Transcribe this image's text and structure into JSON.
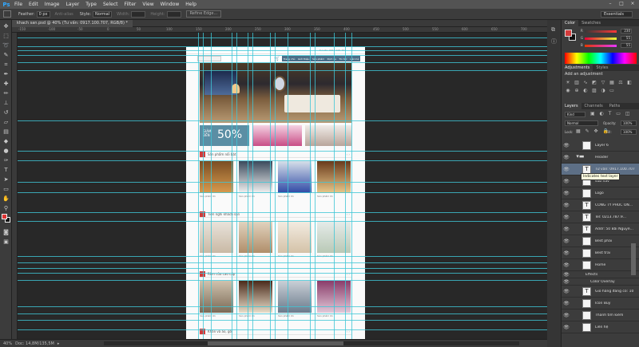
{
  "app": {
    "logo": "Ps"
  },
  "menu": [
    "File",
    "Edit",
    "Image",
    "Layer",
    "Type",
    "Select",
    "Filter",
    "View",
    "Window",
    "Help"
  ],
  "window_controls": [
    "–",
    "□",
    "×"
  ],
  "options_bar": {
    "feather_label": "Feather:",
    "feather_value": "0 px",
    "anti_alias": "Anti-alias",
    "style_label": "Style:",
    "style_value": "Normal",
    "width_label": "Width:",
    "height_label": "Height:",
    "refine_edge": "Refine Edge...",
    "workspace": "Essentials"
  },
  "document": {
    "tab_title": "khach san.psd @ 40% (Tư vấn: 0917.100.707, RGB/8) *",
    "zoom": "40%",
    "doc_size": "Doc: 14,8M/135,5M",
    "bottom_tabs": [
      "Mini Bridge",
      "Timeline"
    ]
  },
  "ruler_ticks": [
    "-150",
    "-100",
    "-50",
    "0",
    "50",
    "100",
    "150",
    "200",
    "250",
    "300",
    "350",
    "400",
    "450",
    "500",
    "550",
    "600",
    "650",
    "700"
  ],
  "site": {
    "top_right": "Tư vấn: 0917.100.707",
    "nav": [
      "Trang chủ",
      "Giới thiệu",
      "Sản phẩm",
      "Dịch vụ",
      "Tin tức",
      "Liên hệ"
    ],
    "sale_small_1": "GIẢM",
    "sale_small_2": "ĐẾN",
    "sale_big": "50%",
    "sections": [
      "Sản phẩm nổi bật",
      "Tiện nghi khách sạn",
      "Rèm cửa cao cấp",
      "Khăn và áo, gối"
    ],
    "caption": "Sản phẩm 01"
  },
  "panels": {
    "color_tabs": [
      "Color",
      "Swatches"
    ],
    "rgb": [
      {
        "label": "R",
        "value": "230"
      },
      {
        "label": "G",
        "value": "55"
      },
      {
        "label": "B",
        "value": "55"
      }
    ],
    "adjust_tabs": [
      "Adjustments",
      "Styles"
    ],
    "adjust_header": "Add an adjustment",
    "layer_tabs": [
      "Layers",
      "Channels",
      "Paths"
    ],
    "kind": "Kind",
    "blend_mode": "Normal",
    "opacity_label": "Opacity:",
    "opacity_value": "100%",
    "lock_label": "Lock:",
    "fill_label": "Fill:",
    "fill_value": "100%",
    "tooltip": "Indicates text layer",
    "layers": [
      {
        "name": "Layer 6",
        "type": "image"
      },
      {
        "name": "Header",
        "type": "folder"
      },
      {
        "name": "Tư vấn: 0917.100.707",
        "type": "text",
        "selected": true
      },
      {
        "name": "sub nav",
        "type": "image"
      },
      {
        "name": "Logo",
        "type": "image"
      },
      {
        "name": "CÔNG TY PHÚC ON...",
        "type": "text"
      },
      {
        "name": "Tel: 0213.787.9...",
        "type": "text"
      },
      {
        "name": "Addr: 50 Bãi Nguyễ...",
        "type": "text"
      },
      {
        "name": "Best phải",
        "type": "image"
      },
      {
        "name": "Best trai",
        "type": "image"
      },
      {
        "name": "Home",
        "type": "image"
      },
      {
        "name": "Effects",
        "type": "effect"
      },
      {
        "name": "Color Overlay",
        "type": "effect"
      },
      {
        "name": "Giỏ hàng đang có: 10",
        "type": "text"
      },
      {
        "name": "Icon Buy",
        "type": "image"
      },
      {
        "name": "Thanh tìm kiếm",
        "type": "image"
      },
      {
        "name": "Liên hệ",
        "type": "image"
      }
    ]
  }
}
